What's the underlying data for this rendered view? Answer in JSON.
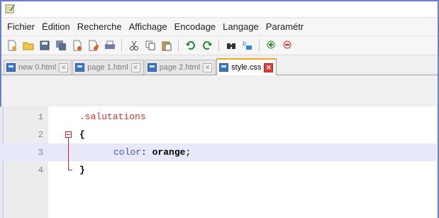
{
  "menu": {
    "items": [
      "Fichier",
      "Édition",
      "Recherche",
      "Affichage",
      "Encodage",
      "Langage",
      "Paramétr"
    ]
  },
  "toolbar": {
    "icons": [
      "new-file-icon",
      "open-file-icon",
      "save-icon",
      "save-all-icon",
      "close-icon",
      "close-all-icon",
      "print-icon",
      "cut-icon",
      "copy-icon",
      "paste-icon",
      "undo-icon",
      "redo-icon",
      "find-icon",
      "replace-icon",
      "zoom-in-icon",
      "zoom-out-icon"
    ]
  },
  "tabs": [
    {
      "label": "new  0.html",
      "active": false
    },
    {
      "label": "page 1.html",
      "active": false
    },
    {
      "label": "page 2.html",
      "active": false
    },
    {
      "label": "style.css",
      "active": true
    }
  ],
  "editor": {
    "lines": [
      {
        "num": "1",
        "text": ".salutations"
      },
      {
        "num": "2",
        "text": "{"
      },
      {
        "num": "3",
        "prop": "color",
        "colon": ": ",
        "value": "orange",
        "semi": ";"
      },
      {
        "num": "4",
        "text": "}"
      }
    ]
  },
  "colors": {
    "accent_tab": "#f5a623",
    "current_line": "#e8e8fb",
    "selector": "#e03030",
    "fold_marker": "#cc2222"
  }
}
